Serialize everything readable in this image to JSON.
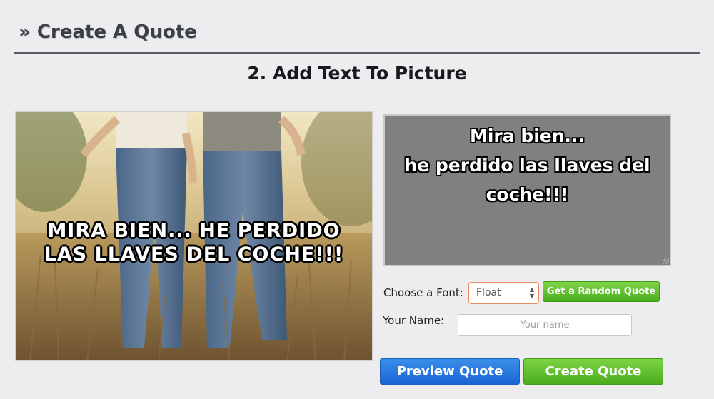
{
  "header": {
    "title": "» Create A Quote"
  },
  "step": {
    "title": "2. Add Text To Picture"
  },
  "preview": {
    "overlay_text": "Mira bien... he perdido las llaves del coche!!!"
  },
  "quote_text": "Mira bien...\nhe perdido las llaves del\ncoche!!!",
  "font": {
    "label": "Choose a Font:",
    "selected": "Float"
  },
  "random_quote_button": "Get a Random Quote",
  "name": {
    "label": "Your Name:",
    "placeholder": "Your name"
  },
  "preview_button": "Preview Quote",
  "create_button": "Create Quote",
  "colors": {
    "textarea_bg": "#808080",
    "preview_button": "#2a7ae0",
    "create_button": "#5cbf2a",
    "select_border": "#e98b61"
  }
}
